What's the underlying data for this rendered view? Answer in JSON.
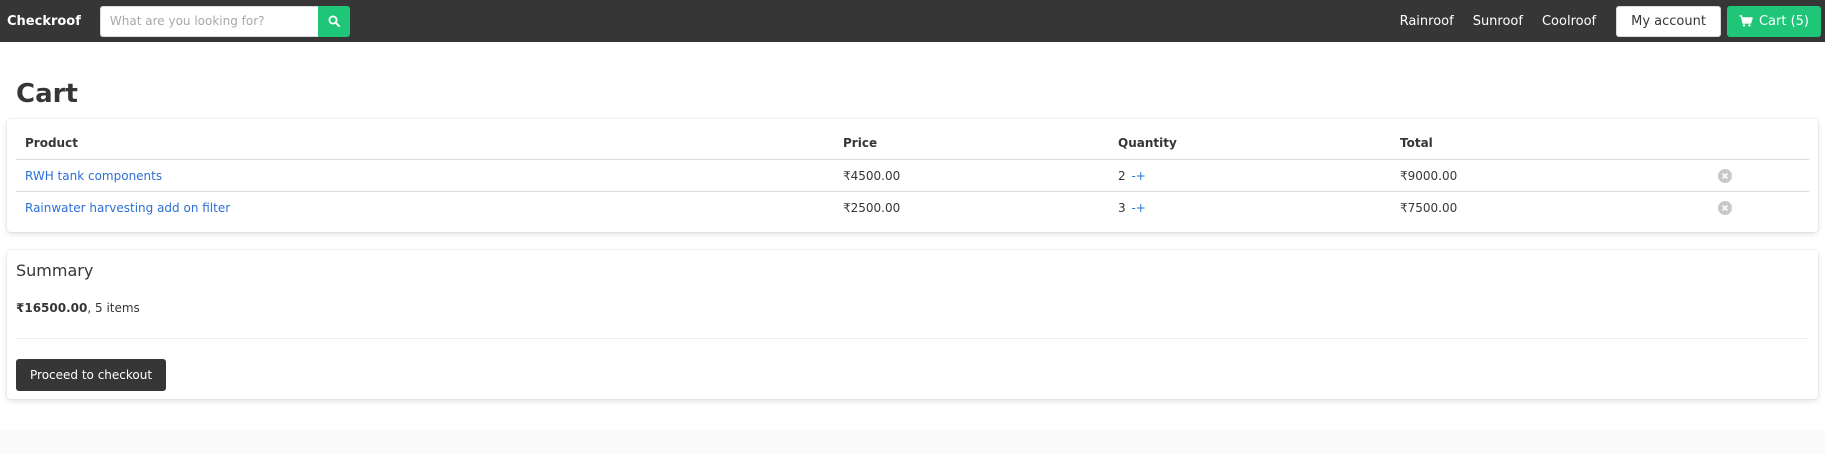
{
  "navbar": {
    "brand": "Checkroof",
    "search_placeholder": "What are you looking for?",
    "search_icon": "search-icon",
    "links": [
      "Rainroof",
      "Sunroof",
      "Coolroof"
    ],
    "account_label": "My account",
    "cart_label": "Cart (5)",
    "cart_icon": "shopping-cart-icon"
  },
  "page": {
    "title": "Cart"
  },
  "cart": {
    "columns": [
      "Product",
      "Price",
      "Quantity",
      "Total"
    ],
    "rows": [
      {
        "product": "RWH tank components",
        "price": "₹4500.00",
        "quantity": "2",
        "quantity_action": "-+",
        "total": "₹9000.00"
      },
      {
        "product": "Rainwater harvesting add on filter",
        "price": "₹2500.00",
        "quantity": "3",
        "quantity_action": "-+",
        "total": "₹7500.00"
      }
    ]
  },
  "summary": {
    "title": "Summary",
    "total": "₹16500.00",
    "items_text": ", 5 items",
    "checkout_label": "Proceed to checkout"
  },
  "colors": {
    "navbar": "#363636",
    "accent_green": "#1fc678",
    "link_blue": "#2d6fd6"
  }
}
